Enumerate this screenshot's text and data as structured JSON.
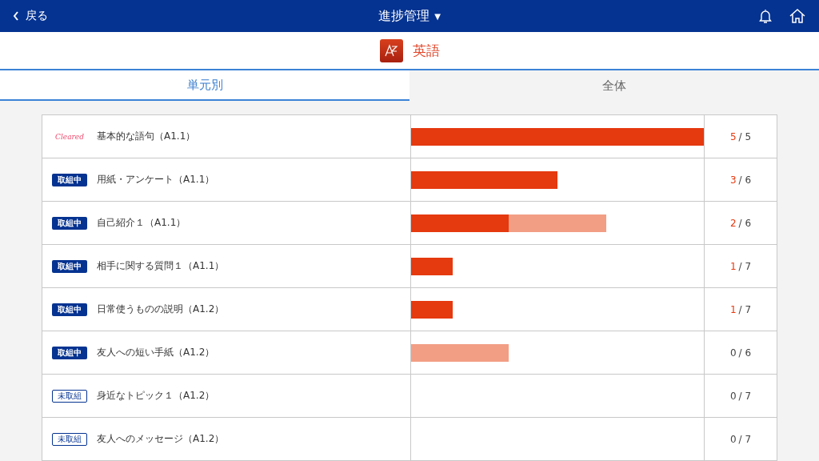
{
  "header": {
    "back_label": "戻る",
    "title": "進捗管理",
    "title_caret": "▼"
  },
  "subject": {
    "name": "英語"
  },
  "tabs": [
    {
      "label": "単元別",
      "selected": true
    },
    {
      "label": "全体",
      "selected": false
    }
  ],
  "units": [
    {
      "kind": "cleared",
      "badge": "Cleared",
      "name": "基本的な語句（A1.1）",
      "progress": {
        "level": 1.0
      },
      "done": "5",
      "total": "/ 5"
    },
    {
      "kind": "active",
      "badge": "取組中",
      "name": "用紙・アンケート（A1.1）",
      "progress": {
        "level": 0.5
      },
      "done": "3",
      "total": "/ 6"
    },
    {
      "kind": "active",
      "badge": "取組中",
      "name": "自己紹介１（A1.1）",
      "progress": {
        "level": 0.333
      },
      "attempted": {
        "level": 0.667
      },
      "done": "2",
      "total": "/ 6"
    },
    {
      "kind": "active",
      "badge": "取組中",
      "name": "相手に関する質問１（A1.1）",
      "progress": {
        "level": 0.143
      },
      "done": "1",
      "total": "/ 7"
    },
    {
      "kind": "active",
      "badge": "取組中",
      "name": "日常使うものの説明（A1.2）",
      "progress": {
        "level": 0.143
      },
      "done": "1",
      "total": "/ 7"
    },
    {
      "kind": "active",
      "badge": "取組中",
      "name": "友人への短い手紙（A1.2）",
      "attempted": {
        "level": 0.333
      },
      "done": "0",
      "total": "/ 6"
    },
    {
      "kind": "untouched",
      "badge": "未取組",
      "name": "身近なトピック１（A1.2）",
      "done": "0",
      "total": "/ 7"
    },
    {
      "kind": "untouched",
      "badge": "未取組",
      "name": "友人へのメッセージ（A1.2）",
      "done": "0",
      "total": "/ 7"
    }
  ]
}
